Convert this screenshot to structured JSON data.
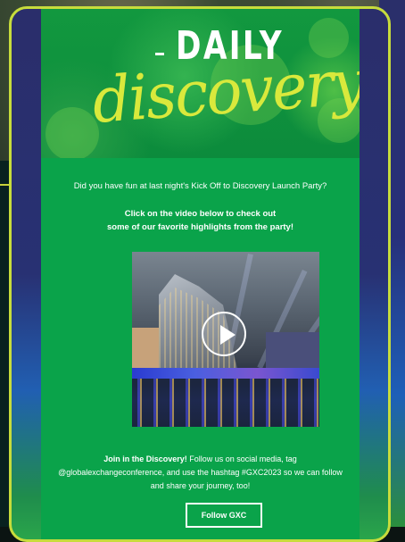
{
  "banner": {
    "title_top": "DAILY",
    "title_script": "discovery"
  },
  "email": {
    "intro": "Did you have fun at last night's Kick Off to Discovery Launch Party?",
    "highlight_line1": "Click on the video below to check out",
    "highlight_line2": "some of our favorite highlights from the party!",
    "join_bold": "Join in the Discovery!",
    "join_line1_rest": " Follow us on social media, tag",
    "join_line2": "@globalexchangeconference, and use the hashtag #GXC2023 so we can follow",
    "join_line3": "and share your journey, too!",
    "button_label": "Follow GXC"
  },
  "video": {
    "icon": "play-icon"
  },
  "colors": {
    "email_bg": "#0aa34a",
    "accent_yellow": "#d9e93c",
    "frame_border": "#c7dc3c"
  }
}
